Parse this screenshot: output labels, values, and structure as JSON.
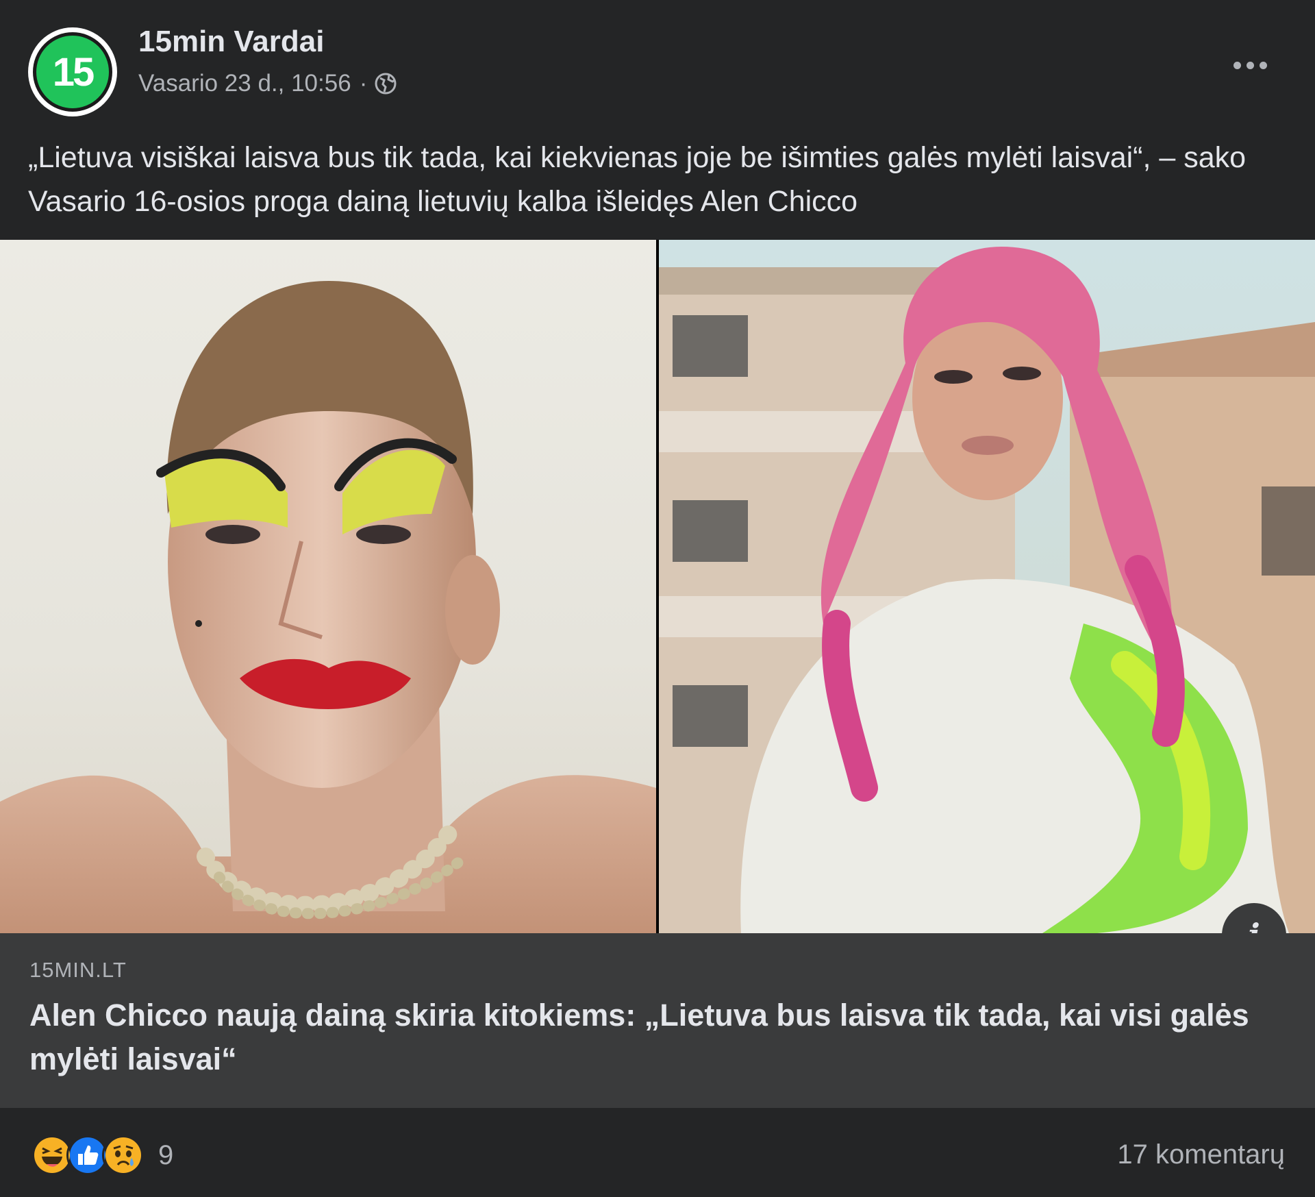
{
  "post": {
    "page_name": "15min Vardai",
    "avatar_text": "15",
    "timestamp": "Vasario 23 d., 10:56",
    "separator": "·",
    "audience_icon": "globe-icon",
    "menu_icon": "more-options-icon",
    "caption": "„Lietuva visiškai laisva bus tik tada, kai kiekvienas joje be išimties galės mylėti laisvai“, – sako Vasario 16-osios proga dainą lietuvių kalba išleidęs Alen Chicco"
  },
  "link_preview": {
    "domain": "15MIN.LT",
    "title": "Alen Chicco naują dainą skiria kitokiems: „Lietuva bus laisva tik tada, kai visi galės mylėti laisvai“",
    "info_icon": "info-icon",
    "info_label": "i"
  },
  "footer": {
    "reaction_icons": [
      "haha-icon",
      "like-icon",
      "sad-icon"
    ],
    "reaction_count": "9",
    "comments_label": "17 komentarų"
  },
  "colors": {
    "background": "#242526",
    "link_box": "#3a3b3c",
    "text_primary": "#e4e6eb",
    "text_secondary": "#b0b3b8",
    "avatar_green": "#20c35a",
    "like_blue": "#1877f2",
    "reaction_yellow": "#f7b125"
  }
}
